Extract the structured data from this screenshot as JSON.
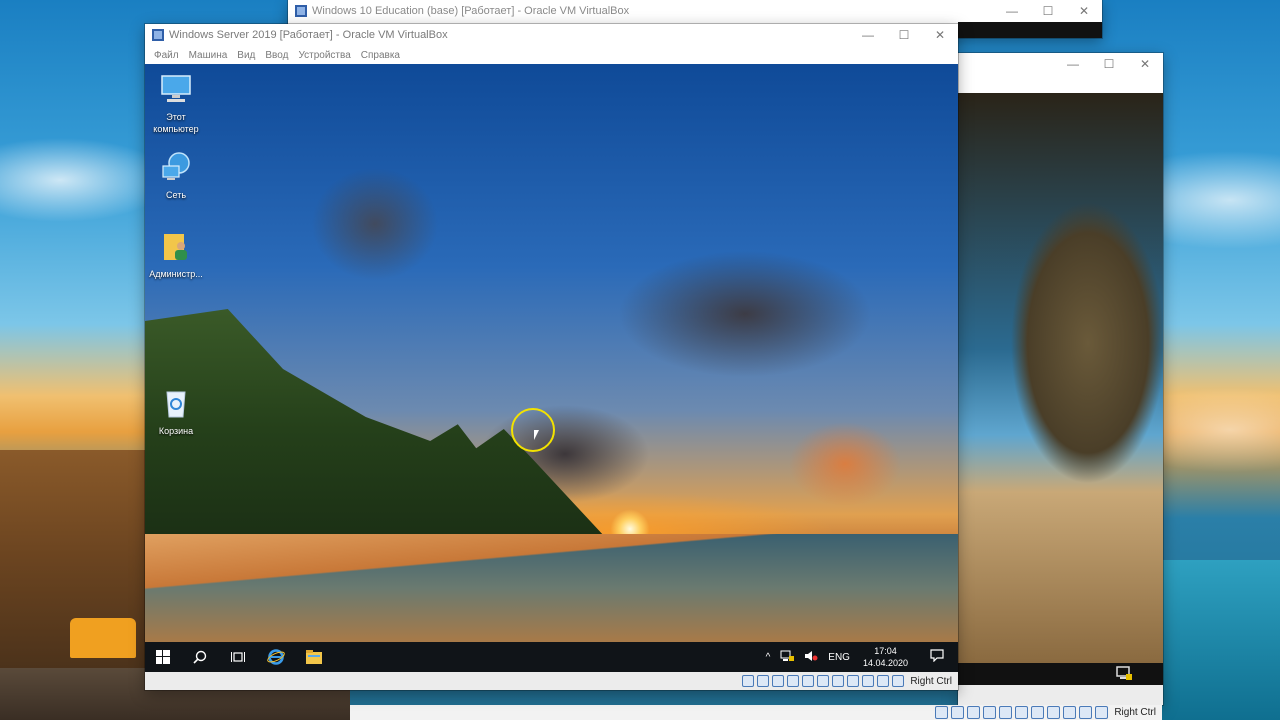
{
  "windows": {
    "back": {
      "title": "Windows 10 Education (base) [Работает] - Oracle VM VirtualBox",
      "controls": {
        "minimize": "—",
        "maximize": "☐",
        "close": "✕"
      }
    },
    "middle": {
      "controls": {
        "minimize": "—",
        "maximize": "☐",
        "close": "✕"
      }
    },
    "front": {
      "title": "Windows Server 2019 [Работает] - Oracle VM VirtualBox",
      "controls": {
        "minimize": "—",
        "maximize": "☐",
        "close": "✕"
      },
      "menu": [
        "Файл",
        "Машина",
        "Вид",
        "Ввод",
        "Устройства",
        "Справка"
      ],
      "desktop_icons": [
        {
          "label": "Этот компьютер",
          "icon": "computer-icon"
        },
        {
          "label": "Сеть",
          "icon": "network-icon"
        },
        {
          "label": "Администр...",
          "icon": "user-folder-icon"
        },
        {
          "label": "Корзина",
          "icon": "recycle-bin-icon"
        }
      ],
      "taskbar": {
        "tray": {
          "chevron": "^",
          "language": "ENG"
        },
        "time": "17:04",
        "date": "14.04.2020"
      },
      "host_key": "Right Ctrl"
    }
  },
  "host_statusbar": {
    "host_key": "Right Ctrl"
  }
}
